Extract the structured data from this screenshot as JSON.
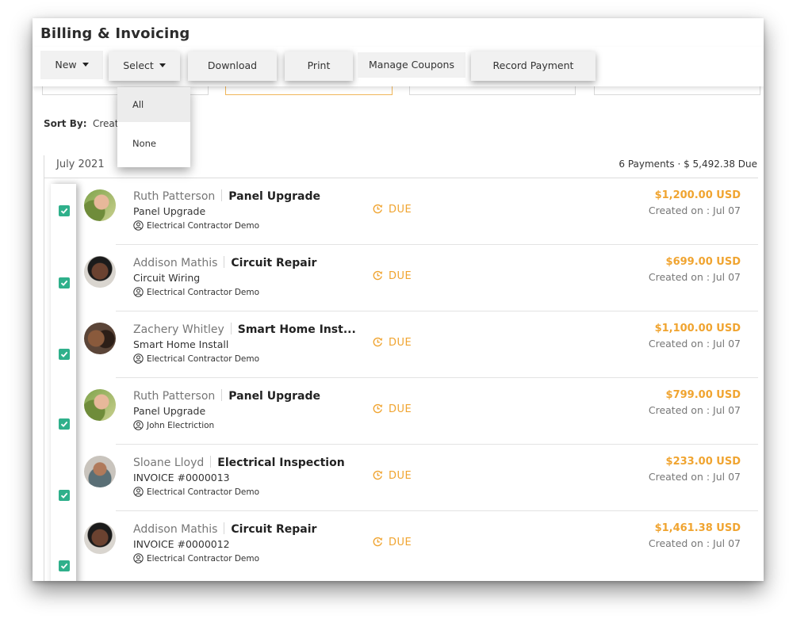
{
  "page": {
    "title": "Billing & Invoicing"
  },
  "toolbar": {
    "new_label": "New",
    "select_label": "Select",
    "download_label": "Download",
    "print_label": "Print",
    "coupons_label": "Manage Coupons",
    "record_label": "Record Payment"
  },
  "select_menu": {
    "items": [
      {
        "label": "All",
        "active": true
      },
      {
        "label": "None",
        "active": false
      }
    ]
  },
  "sort": {
    "label": "Sort By:",
    "value": "Creat"
  },
  "group": {
    "month": "July 2021",
    "summary": "6 Payments  ·  $ 5,492.38 Due"
  },
  "colors": {
    "accent": "#f0a430",
    "check": "#2fb08b"
  },
  "payments": [
    {
      "customer": "Ruth Patterson",
      "project": "Panel Upgrade",
      "subtitle": "Panel Upgrade",
      "owner": "Electrical Contractor Demo",
      "status": "DUE",
      "amount": "$1,200.00 USD",
      "created": "Created on : Jul 07",
      "checked": true,
      "avatar": "a1"
    },
    {
      "customer": "Addison Mathis",
      "project": "Circuit Repair",
      "subtitle": "Circuit Wiring",
      "owner": "Electrical Contractor Demo",
      "status": "DUE",
      "amount": "$699.00 USD",
      "created": "Created on : Jul 07",
      "checked": true,
      "avatar": "a2"
    },
    {
      "customer": "Zachery Whitley",
      "project": "Smart Home Inst...",
      "subtitle": "Smart Home Install",
      "owner": "Electrical Contractor Demo",
      "status": "DUE",
      "amount": "$1,100.00 USD",
      "created": "Created on : Jul 07",
      "checked": true,
      "avatar": "a3"
    },
    {
      "customer": "Ruth Patterson",
      "project": "Panel Upgrade",
      "subtitle": "Panel Upgrade",
      "owner": "John Electriction",
      "status": "DUE",
      "amount": "$799.00 USD",
      "created": "Created on : Jul 07",
      "checked": true,
      "avatar": "a1"
    },
    {
      "customer": "Sloane Lloyd",
      "project": "Electrical Inspection",
      "subtitle": "INVOICE #0000013",
      "owner": "Electrical Contractor Demo",
      "status": "DUE",
      "amount": "$233.00 USD",
      "created": "Created on : Jul 07",
      "checked": true,
      "avatar": "a4"
    },
    {
      "customer": "Addison Mathis",
      "project": "Circuit Repair",
      "subtitle": "INVOICE #0000012",
      "owner": "Electrical Contractor Demo",
      "status": "DUE",
      "amount": "$1,461.38 USD",
      "created": "Created on : Jul 07",
      "checked": true,
      "avatar": "a2"
    }
  ]
}
